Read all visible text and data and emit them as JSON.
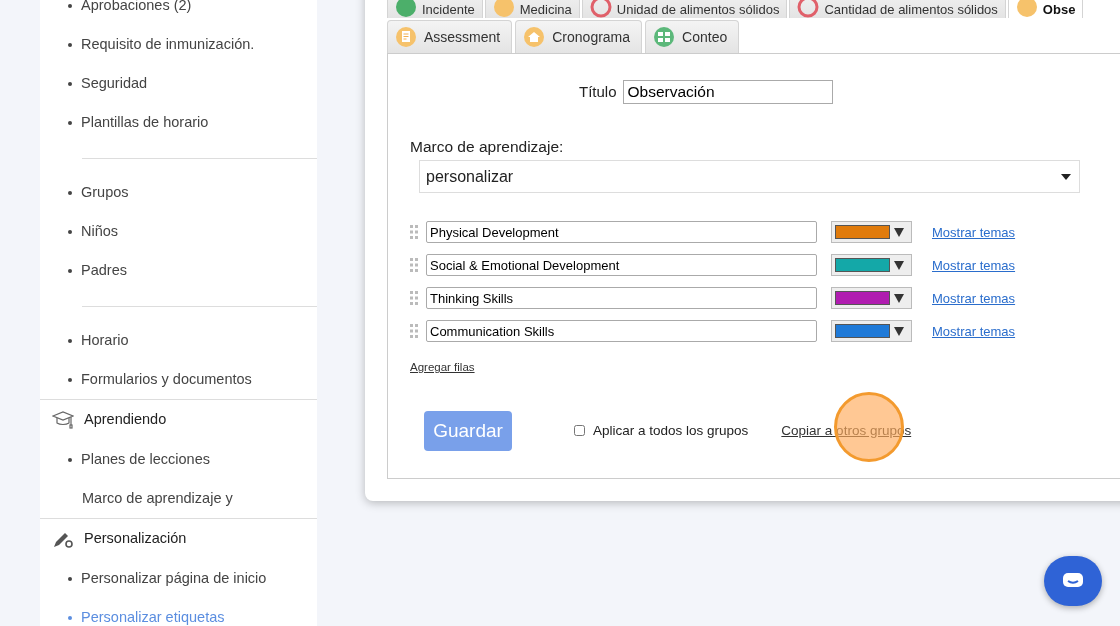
{
  "sidebar": {
    "sections": [
      {
        "items": [
          {
            "label": "Aprobaciones (2)",
            "bullet": true,
            "selected": false
          },
          {
            "label": "Requisito de inmunización.",
            "bullet": true,
            "selected": false
          },
          {
            "label": "Seguridad",
            "bullet": true,
            "selected": false
          },
          {
            "label": "Plantillas de horario",
            "bullet": true,
            "selected": false
          }
        ]
      },
      {
        "items": [
          {
            "label": "Grupos",
            "bullet": true,
            "selected": false
          },
          {
            "label": "Niños",
            "bullet": true,
            "selected": false
          },
          {
            "label": "Padres",
            "bullet": true,
            "selected": false
          }
        ]
      },
      {
        "items": [
          {
            "label": "Horario",
            "bullet": true,
            "selected": false
          },
          {
            "label": "Formularios y documentos",
            "bullet": true,
            "selected": false
          }
        ]
      },
      {
        "header": {
          "label": "Aprendiendo"
        },
        "items": [
          {
            "label": "Planes de lecciones",
            "bullet": true,
            "selected": false
          },
          {
            "label": "Marco de aprendizaje y",
            "bullet": false,
            "selected": false
          }
        ]
      },
      {
        "header": {
          "label": "Personalización"
        },
        "items": [
          {
            "label": "Personalizar página de inicio",
            "bullet": true,
            "selected": false
          },
          {
            "label": "Personalizar etiquetas",
            "bullet": true,
            "selected": true
          }
        ]
      }
    ]
  },
  "tab_rows": [
    [
      {
        "label": "Incidente",
        "selected": false
      },
      {
        "label": "Medicina",
        "selected": false
      },
      {
        "label": "Unidad de alimentos sólidos",
        "selected": false
      },
      {
        "label": "Cantidad de alimentos sólidos",
        "selected": false
      },
      {
        "label": "Obse",
        "selected": true
      }
    ],
    [
      {
        "label": "Assessment",
        "selected": false
      },
      {
        "label": "Cronograma",
        "selected": false
      },
      {
        "label": "Conteo",
        "selected": false
      }
    ]
  ],
  "form": {
    "title_label": "Título",
    "title_value": "Observación",
    "framework_label": "Marco de aprendizaje:",
    "framework_value": "personalizar",
    "categories": [
      {
        "name": "Physical Development",
        "color": "#e07b0c",
        "link": "Mostrar temas"
      },
      {
        "name": "Social & Emotional Development",
        "color": "#14a8a8",
        "link": "Mostrar temas"
      },
      {
        "name": "Thinking Skills",
        "color": "#b01cb0",
        "link": "Mostrar temas"
      },
      {
        "name": "Communication Skills",
        "color": "#1f7ad8",
        "link": "Mostrar temas"
      }
    ],
    "add_rows": "Agregar filas",
    "save": "Guardar",
    "apply_all": {
      "label": "Aplicar a todos los grupos",
      "checked": false
    },
    "copy": "Copiar a otros grupos"
  }
}
